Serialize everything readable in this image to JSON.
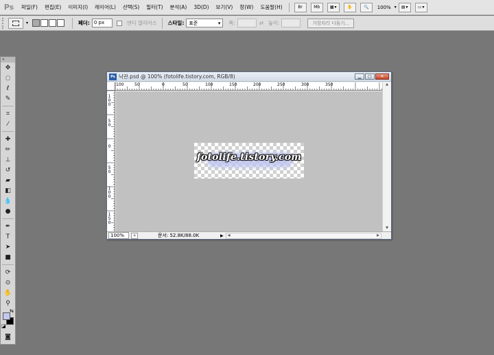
{
  "app": {
    "logo": "Ps"
  },
  "menu": {
    "items": [
      "파일(F)",
      "편집(E)",
      "이미지(I)",
      "레이어(L)",
      "선택(S)",
      "필터(T)",
      "분석(A)",
      "3D(D)",
      "보기(V)",
      "창(W)",
      "도움말(H)"
    ],
    "bridge_label": "Br",
    "minibridge_label": "Mb",
    "zoom_level": "100%"
  },
  "options_bar": {
    "feather_label": "페더:",
    "feather_value": "0 px",
    "antialias_label": "앤티 앨리어스",
    "style_label": "스타일:",
    "style_value": "표준",
    "width_label": "폭:",
    "height_label": "높이:",
    "refine_edge_label": "가장자리 다듬기..."
  },
  "toolbox": {
    "tools": [
      "move-tool",
      "marquee-tool",
      "lasso-tool",
      "quick-selection-tool",
      "crop-tool",
      "eyedropper-tool",
      "spot-healing-tool",
      "brush-tool",
      "clone-stamp-tool",
      "history-brush-tool",
      "eraser-tool",
      "gradient-tool",
      "blur-tool",
      "dodge-tool",
      "pen-tool",
      "type-tool",
      "path-selection-tool",
      "shape-tool",
      "3d-rotate-tool",
      "3d-orbit-tool",
      "hand-tool",
      "zoom-tool"
    ],
    "foreground_color": "#c2c8ef",
    "background_color": "#000000"
  },
  "document": {
    "title": "낙관.psd @ 100% (fotolife.tistory.com, RGB/8)",
    "ruler_h_labels": [
      "100",
      "50",
      "0",
      "50",
      "100",
      "150",
      "200",
      "250",
      "300",
      "350"
    ],
    "ruler_v_labels": [
      "100",
      "50",
      "0",
      "50",
      "100",
      "150"
    ],
    "image_text": "fotolife.tistory.com",
    "zoom_value": "100%",
    "doc_size": "문서: 52.8K/88.0K"
  }
}
